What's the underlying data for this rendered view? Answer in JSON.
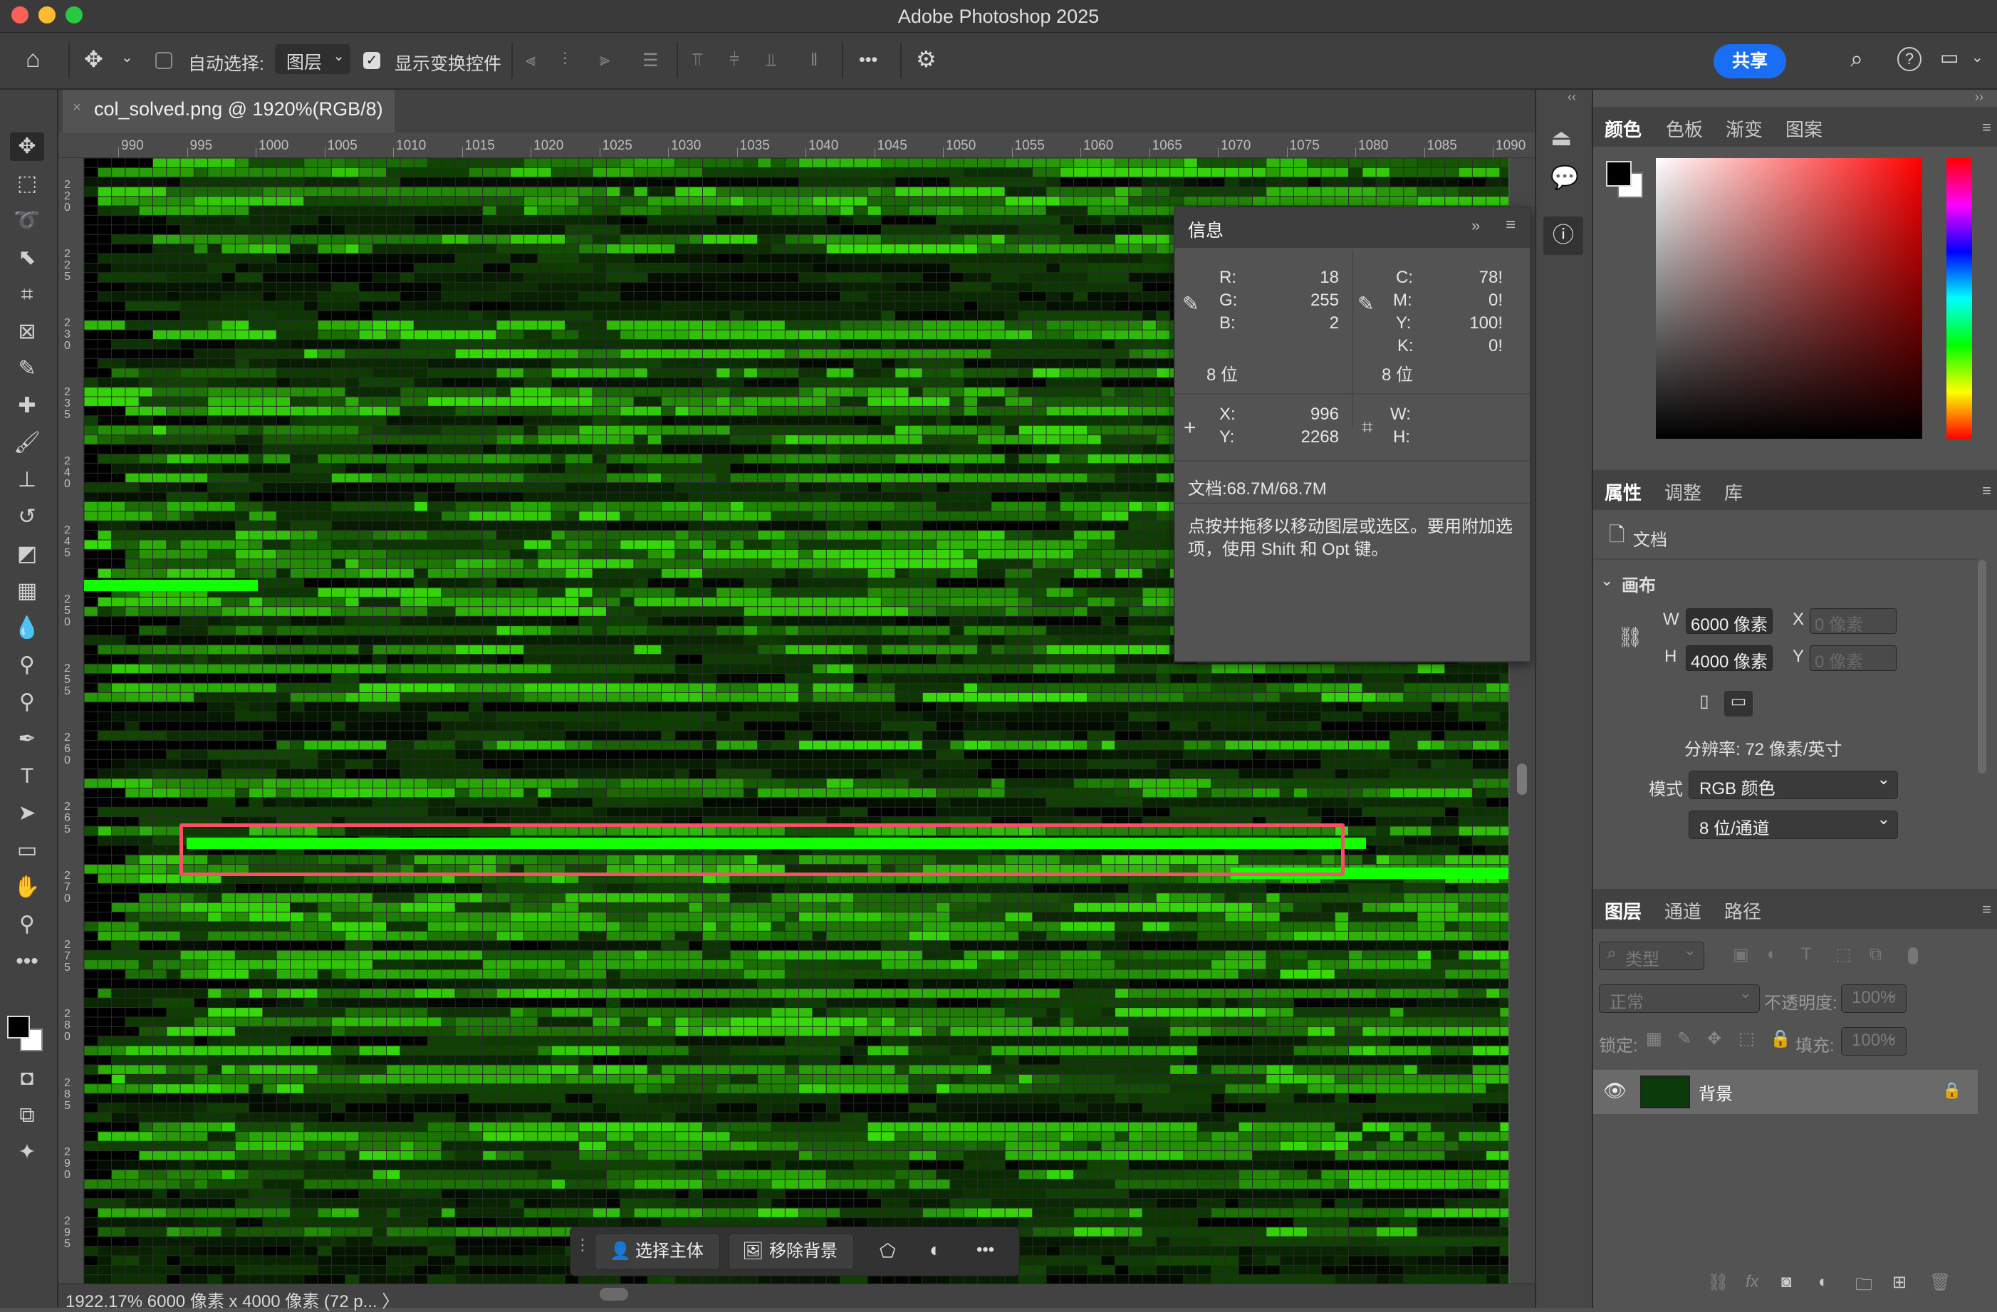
{
  "window": {
    "title": "Adobe Photoshop 2025",
    "traffic_colors": [
      "#fe5f57",
      "#febc2e",
      "#28c840"
    ]
  },
  "options_bar": {
    "auto_select_label": "自动选择:",
    "auto_select_target": "图层",
    "show_transform_label": "显示变换控件",
    "share_label": "共享",
    "more_glyph": "•••"
  },
  "document": {
    "tab_title": "col_solved.png @ 1920%(RGB/8)",
    "status": "1922.17% 6000 像素 x 4000 像素 (72 p...  〉"
  },
  "ruler": {
    "top_labels": [
      "990",
      "995",
      "1000",
      "1005",
      "1010",
      "1015",
      "1020",
      "1025",
      "1030",
      "1035",
      "1040",
      "1045",
      "1050",
      "1055",
      "1060",
      "1065",
      "1070",
      "1075",
      "1080",
      "1085",
      "1090"
    ],
    "left_labels": [
      "220",
      "225",
      "230",
      "235",
      "240",
      "245",
      "250",
      "255",
      "260",
      "265",
      "270",
      "275",
      "280",
      "285",
      "290",
      "295"
    ]
  },
  "canvas": {
    "highlight_color": "#ff3b3b",
    "bright_green": "#12ff02"
  },
  "context_bar": {
    "select_subject": "选择主体",
    "remove_bg": "移除背景",
    "more": "•••"
  },
  "info_panel": {
    "title": "信息",
    "r_label": "R:",
    "r": "18",
    "g_label": "G:",
    "g": "255",
    "b_label": "B:",
    "b": "2",
    "bits_left": "8 位",
    "c_label": "C:",
    "c": "78!",
    "m_label": "M:",
    "m": "0!",
    "y_label": "Y:",
    "y": "100!",
    "k_label": "K:",
    "k": "0!",
    "bits_right": "8 位",
    "x_label": "X:",
    "x": "996",
    "yy_label": "Y:",
    "yy": "2268",
    "w_label": "W:",
    "h_label": "H:",
    "doc_size": "文档:68.7M/68.7M",
    "hint": "点按并拖移以移动图层或选区。要用附加选项，使用 Shift 和 Opt 键。"
  },
  "color_panel": {
    "tabs": [
      "颜色",
      "色板",
      "渐变",
      "图案"
    ],
    "fg": "#000000",
    "bg": "#ffffff"
  },
  "properties_panel": {
    "tabs": [
      "属性",
      "调整",
      "库"
    ],
    "doc_label": "文档",
    "section": "画布",
    "w_label": "W",
    "w_value": "6000 像素",
    "h_label": "H",
    "h_value": "4000 像素",
    "x_label": "X",
    "x_placeholder": "0 像素",
    "y_label": "Y",
    "y_placeholder": "0 像素",
    "resolution": "分辨率: 72 像素/英寸",
    "mode_label": "模式",
    "mode_value": "RGB 颜色",
    "depth_value": "8 位/通道"
  },
  "layers_panel": {
    "tabs": [
      "图层",
      "通道",
      "路径"
    ],
    "filter_label": "类型",
    "blend_mode": "正常",
    "opacity_label": "不透明度:",
    "opacity": "100%",
    "lock_label": "锁定:",
    "fill_label": "填充:",
    "fill": "100%",
    "layer_name": "背景"
  }
}
